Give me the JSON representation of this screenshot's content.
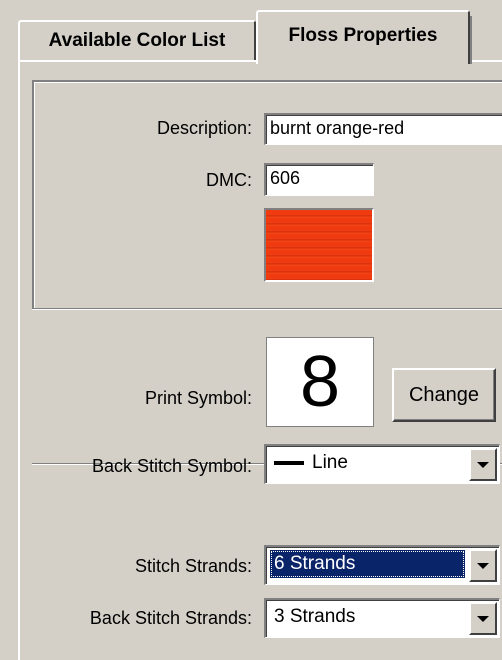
{
  "tabs": [
    {
      "label": "Available Color List",
      "active": false
    },
    {
      "label": "Floss Properties",
      "active": true
    }
  ],
  "floss": {
    "description_label": "Description:",
    "description_value": "burnt orange-red",
    "dmc_label": "DMC:",
    "dmc_value": "606",
    "swatch_color": "#f03a10",
    "print_symbol_label": "Print Symbol:",
    "print_symbol_value": "8",
    "change_button": "Change",
    "back_stitch_symbol_label": "Back Stitch Symbol:",
    "back_stitch_symbol_value": "Line",
    "back_stitch_symbol_icon": "line-glyph",
    "stitch_strands_label": "Stitch Strands:",
    "stitch_strands_value": "6 Strands",
    "back_stitch_strands_label": "Back Stitch Strands:",
    "back_stitch_strands_value": "3 Strands"
  },
  "colors": {
    "window_bg": "#d4d0c8",
    "selection_bg": "#0a246a",
    "swatch": "#f03a10"
  }
}
